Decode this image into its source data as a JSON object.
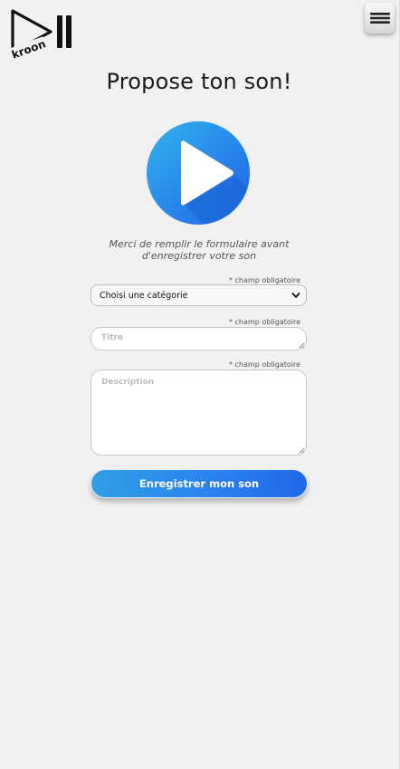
{
  "brand": {
    "logo_text": "Kroon"
  },
  "menu": {
    "icon": "hamburger-icon"
  },
  "page": {
    "title": "Propose ton son!",
    "intro": "Merci de remplir le formulaire avant d'enregistrer votre son"
  },
  "form": {
    "required_note": "* champ obligatoire",
    "category": {
      "selected": "Choisi une catégorie"
    },
    "titre": {
      "placeholder": "Titre"
    },
    "description": {
      "placeholder": "Description"
    },
    "submit_label": "Enregistrer mon son"
  },
  "colors": {
    "accent": "#2b7ff0",
    "accent_light": "#2f9fe6",
    "background": "#f1f1f2"
  }
}
